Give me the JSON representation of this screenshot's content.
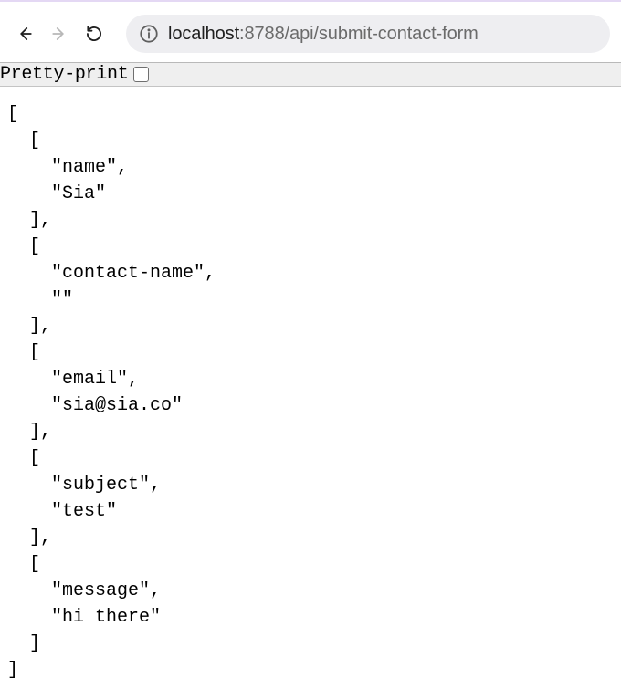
{
  "toolbar": {
    "url": {
      "display_host": "localhost",
      "display_rest": ":8788/api/submit-contact-form"
    }
  },
  "pretty_print": {
    "label": "Pretty-print",
    "checked": false
  },
  "response_json": [
    [
      "name",
      "Sia"
    ],
    [
      "contact-name",
      ""
    ],
    [
      "email",
      "sia@sia.co"
    ],
    [
      "subject",
      "test"
    ],
    [
      "message",
      "hi there"
    ]
  ]
}
